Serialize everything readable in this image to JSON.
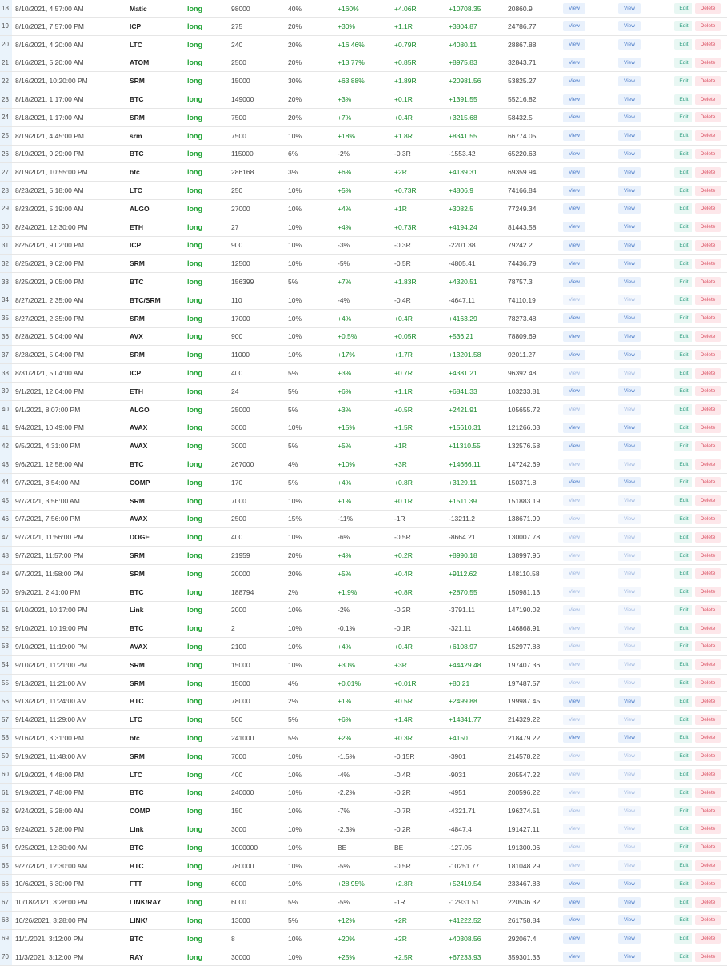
{
  "buttons": {
    "view": "View",
    "edit": "Edit",
    "delete": "Delete"
  },
  "colors": {
    "positive": "#178a2b",
    "long": "#21a336",
    "view_bg": "#e9f1fc",
    "edit_bg": "#e8f7f3",
    "delete_bg": "#fde7ea",
    "row_number_bg": "#eaf3fb"
  },
  "rows": [
    {
      "num": "18",
      "date": "8/10/2021, 4:57:00 AM",
      "coin": "Matic",
      "direction": "long",
      "size": "98000",
      "risk": "40%",
      "pct": "+160%",
      "r": "+4.06R",
      "pnl": "+10708.35",
      "balance": "20860.9"
    },
    {
      "num": "19",
      "date": "8/10/2021, 7:57:00 PM",
      "coin": "ICP",
      "direction": "long",
      "size": "275",
      "risk": "20%",
      "pct": "+30%",
      "r": "+1.1R",
      "pnl": "+3804.87",
      "balance": "24786.77"
    },
    {
      "num": "20",
      "date": "8/16/2021, 4:20:00 AM",
      "coin": "LTC",
      "direction": "long",
      "size": "240",
      "risk": "20%",
      "pct": "+16.46%",
      "r": "+0.79R",
      "pnl": "+4080.11",
      "balance": "28867.88"
    },
    {
      "num": "21",
      "date": "8/16/2021, 5:20:00 AM",
      "coin": "ATOM",
      "direction": "long",
      "size": "2500",
      "risk": "20%",
      "pct": "+13.77%",
      "r": "+0.85R",
      "pnl": "+8975.83",
      "balance": "32843.71"
    },
    {
      "num": "22",
      "date": "8/16/2021, 10:20:00 PM",
      "coin": "SRM",
      "direction": "long",
      "size": "15000",
      "risk": "30%",
      "pct": "+63.88%",
      "r": "+1.89R",
      "pnl": "+20981.56",
      "balance": "53825.27"
    },
    {
      "num": "23",
      "date": "8/18/2021, 1:17:00 AM",
      "coin": "BTC",
      "direction": "long",
      "size": "149000",
      "risk": "20%",
      "pct": "+3%",
      "r": "+0.1R",
      "pnl": "+1391.55",
      "balance": "55216.82"
    },
    {
      "num": "24",
      "date": "8/18/2021, 1:17:00 AM",
      "coin": "SRM",
      "direction": "long",
      "size": "7500",
      "risk": "20%",
      "pct": "+7%",
      "r": "+0.4R",
      "pnl": "+3215.68",
      "balance": "58432.5"
    },
    {
      "num": "25",
      "date": "8/19/2021, 4:45:00 PM",
      "coin": "srm",
      "direction": "long",
      "size": "7500",
      "risk": "10%",
      "pct": "+18%",
      "r": "+1.8R",
      "pnl": "+8341.55",
      "balance": "66774.05"
    },
    {
      "num": "26",
      "date": "8/19/2021, 9:29:00 PM",
      "coin": "BTC",
      "direction": "long",
      "size": "115000",
      "risk": "6%",
      "pct": "-2%",
      "r": "-0.3R",
      "pnl": "-1553.42",
      "balance": "65220.63"
    },
    {
      "num": "27",
      "date": "8/19/2021, 10:55:00 PM",
      "coin": "btc",
      "direction": "long",
      "size": "286168",
      "risk": "3%",
      "pct": "+6%",
      "r": "+2R",
      "pnl": "+4139.31",
      "balance": "69359.94"
    },
    {
      "num": "28",
      "date": "8/23/2021, 5:18:00 AM",
      "coin": "LTC",
      "direction": "long",
      "size": "250",
      "risk": "10%",
      "pct": "+5%",
      "r": "+0.73R",
      "pnl": "+4806.9",
      "balance": "74166.84"
    },
    {
      "num": "29",
      "date": "8/23/2021, 5:19:00 AM",
      "coin": "ALGO",
      "direction": "long",
      "size": "27000",
      "risk": "10%",
      "pct": "+4%",
      "r": "+1R",
      "pnl": "+3082.5",
      "balance": "77249.34"
    },
    {
      "num": "30",
      "date": "8/24/2021, 12:30:00 PM",
      "coin": "ETH",
      "direction": "long",
      "size": "27",
      "risk": "10%",
      "pct": "+4%",
      "r": "+0.73R",
      "pnl": "+4194.24",
      "balance": "81443.58"
    },
    {
      "num": "31",
      "date": "8/25/2021, 9:02:00 PM",
      "coin": "ICP",
      "direction": "long",
      "size": "900",
      "risk": "10%",
      "pct": "-3%",
      "r": "-0.3R",
      "pnl": "-2201.38",
      "balance": "79242.2"
    },
    {
      "num": "32",
      "date": "8/25/2021, 9:02:00 PM",
      "coin": "SRM",
      "direction": "long",
      "size": "12500",
      "risk": "10%",
      "pct": "-5%",
      "r": "-0.5R",
      "pnl": "-4805.41",
      "balance": "74436.79"
    },
    {
      "num": "33",
      "date": "8/25/2021, 9:05:00 PM",
      "coin": "BTC",
      "direction": "long",
      "size": "156399",
      "risk": "5%",
      "pct": "+7%",
      "r": "+1.83R",
      "pnl": "+4320.51",
      "balance": "78757.3"
    },
    {
      "num": "34",
      "date": "8/27/2021, 2:35:00 AM",
      "coin": "BTC/SRM",
      "direction": "long",
      "size": "110",
      "risk": "10%",
      "pct": "-4%",
      "r": "-0.4R",
      "pnl": "-4647.11",
      "balance": "74110.19"
    },
    {
      "num": "35",
      "date": "8/27/2021, 2:35:00 PM",
      "coin": "SRM",
      "direction": "long",
      "size": "17000",
      "risk": "10%",
      "pct": "+4%",
      "r": "+0.4R",
      "pnl": "+4163.29",
      "balance": "78273.48"
    },
    {
      "num": "36",
      "date": "8/28/2021, 5:04:00 AM",
      "coin": "AVX",
      "direction": "long",
      "size": "900",
      "risk": "10%",
      "pct": "+0.5%",
      "r": "+0.05R",
      "pnl": "+536.21",
      "balance": "78809.69"
    },
    {
      "num": "37",
      "date": "8/28/2021, 5:04:00 PM",
      "coin": "SRM",
      "direction": "long",
      "size": "11000",
      "risk": "10%",
      "pct": "+17%",
      "r": "+1.7R",
      "pnl": "+13201.58",
      "balance": "92011.27"
    },
    {
      "num": "38",
      "date": "8/31/2021, 5:04:00 AM",
      "coin": "ICP",
      "direction": "long",
      "size": "400",
      "risk": "5%",
      "pct": "+3%",
      "r": "+0.7R",
      "pnl": "+4381.21",
      "balance": "96392.48"
    },
    {
      "num": "39",
      "date": "9/1/2021, 12:04:00 PM",
      "coin": "ETH",
      "direction": "long",
      "size": "24",
      "risk": "5%",
      "pct": "+6%",
      "r": "+1.1R",
      "pnl": "+6841.33",
      "balance": "103233.81"
    },
    {
      "num": "40",
      "date": "9/1/2021, 8:07:00 PM",
      "coin": "ALGO",
      "direction": "long",
      "size": "25000",
      "risk": "5%",
      "pct": "+3%",
      "r": "+0.5R",
      "pnl": "+2421.91",
      "balance": "105655.72"
    },
    {
      "num": "41",
      "date": "9/4/2021, 10:49:00 PM",
      "coin": "AVAX",
      "direction": "long",
      "size": "3000",
      "risk": "10%",
      "pct": "+15%",
      "r": "+1.5R",
      "pnl": "+15610.31",
      "balance": "121266.03"
    },
    {
      "num": "42",
      "date": "9/5/2021, 4:31:00 PM",
      "coin": "AVAX",
      "direction": "long",
      "size": "3000",
      "risk": "5%",
      "pct": "+5%",
      "r": "+1R",
      "pnl": "+11310.55",
      "balance": "132576.58"
    },
    {
      "num": "43",
      "date": "9/6/2021, 12:58:00 AM",
      "coin": "BTC",
      "direction": "long",
      "size": "267000",
      "risk": "4%",
      "pct": "+10%",
      "r": "+3R",
      "pnl": "+14666.11",
      "balance": "147242.69"
    },
    {
      "num": "44",
      "date": "9/7/2021, 3:54:00 AM",
      "coin": "COMP",
      "direction": "long",
      "size": "170",
      "risk": "5%",
      "pct": "+4%",
      "r": "+0.8R",
      "pnl": "+3129.11",
      "balance": "150371.8"
    },
    {
      "num": "45",
      "date": "9/7/2021, 3:56:00 AM",
      "coin": "SRM",
      "direction": "long",
      "size": "7000",
      "risk": "10%",
      "pct": "+1%",
      "r": "+0.1R",
      "pnl": "+1511.39",
      "balance": "151883.19"
    },
    {
      "num": "46",
      "date": "9/7/2021, 7:56:00 PM",
      "coin": "AVAX",
      "direction": "long",
      "size": "2500",
      "risk": "15%",
      "pct": "-11%",
      "r": "-1R",
      "pnl": "-13211.2",
      "balance": "138671.99"
    },
    {
      "num": "47",
      "date": "9/7/2021, 11:56:00 PM",
      "coin": "DOGE",
      "direction": "long",
      "size": "400",
      "risk": "10%",
      "pct": "-6%",
      "r": "-0.5R",
      "pnl": "-8664.21",
      "balance": "130007.78"
    },
    {
      "num": "48",
      "date": "9/7/2021, 11:57:00 PM",
      "coin": "SRM",
      "direction": "long",
      "size": "21959",
      "risk": "20%",
      "pct": "+4%",
      "r": "+0.2R",
      "pnl": "+8990.18",
      "balance": "138997.96"
    },
    {
      "num": "49",
      "date": "9/7/2021, 11:58:00 PM",
      "coin": "SRM",
      "direction": "long",
      "size": "20000",
      "risk": "20%",
      "pct": "+5%",
      "r": "+0.4R",
      "pnl": "+9112.62",
      "balance": "148110.58"
    },
    {
      "num": "50",
      "date": "9/9/2021, 2:41:00 PM",
      "coin": "BTC",
      "direction": "long",
      "size": "188794",
      "risk": "2%",
      "pct": "+1.9%",
      "r": "+0.8R",
      "pnl": "+2870.55",
      "balance": "150981.13"
    },
    {
      "num": "51",
      "date": "9/10/2021, 10:17:00 PM",
      "coin": "Link",
      "direction": "long",
      "size": "2000",
      "risk": "10%",
      "pct": "-2%",
      "r": "-0.2R",
      "pnl": "-3791.11",
      "balance": "147190.02"
    },
    {
      "num": "52",
      "date": "9/10/2021, 10:19:00 PM",
      "coin": "BTC",
      "direction": "long",
      "size": "2",
      "risk": "10%",
      "pct": "-0.1%",
      "r": "-0.1R",
      "pnl": "-321.11",
      "balance": "146868.91"
    },
    {
      "num": "53",
      "date": "9/10/2021, 11:19:00 PM",
      "coin": "AVAX",
      "direction": "long",
      "size": "2100",
      "risk": "10%",
      "pct": "+4%",
      "r": "+0.4R",
      "pnl": "+6108.97",
      "balance": "152977.88"
    },
    {
      "num": "54",
      "date": "9/10/2021, 11:21:00 PM",
      "coin": "SRM",
      "direction": "long",
      "size": "15000",
      "risk": "10%",
      "pct": "+30%",
      "r": "+3R",
      "pnl": "+44429.48",
      "balance": "197407.36"
    },
    {
      "num": "55",
      "date": "9/13/2021, 11:21:00 AM",
      "coin": "SRM",
      "direction": "long",
      "size": "15000",
      "risk": "4%",
      "pct": "+0.01%",
      "r": "+0.01R",
      "pnl": "+80.21",
      "balance": "197487.57"
    },
    {
      "num": "56",
      "date": "9/13/2021, 11:24:00 AM",
      "coin": "BTC",
      "direction": "long",
      "size": "78000",
      "risk": "2%",
      "pct": "+1%",
      "r": "+0.5R",
      "pnl": "+2499.88",
      "balance": "199987.45"
    },
    {
      "num": "57",
      "date": "9/14/2021, 11:29:00 AM",
      "coin": "LTC",
      "direction": "long",
      "size": "500",
      "risk": "5%",
      "pct": "+6%",
      "r": "+1.4R",
      "pnl": "+14341.77",
      "balance": "214329.22"
    },
    {
      "num": "58",
      "date": "9/16/2021, 3:31:00 PM",
      "coin": "btc",
      "direction": "long",
      "size": "241000",
      "risk": "5%",
      "pct": "+2%",
      "r": "+0.3R",
      "pnl": "+4150",
      "balance": "218479.22"
    },
    {
      "num": "59",
      "date": "9/19/2021, 11:48:00 AM",
      "coin": "SRM",
      "direction": "long",
      "size": "7000",
      "risk": "10%",
      "pct": "-1.5%",
      "r": "-0.15R",
      "pnl": "-3901",
      "balance": "214578.22"
    },
    {
      "num": "60",
      "date": "9/19/2021, 4:48:00 PM",
      "coin": "LTC",
      "direction": "long",
      "size": "400",
      "risk": "10%",
      "pct": "-4%",
      "r": "-0.4R",
      "pnl": "-9031",
      "balance": "205547.22"
    },
    {
      "num": "61",
      "date": "9/19/2021, 7:48:00 PM",
      "coin": "BTC",
      "direction": "long",
      "size": "240000",
      "risk": "10%",
      "pct": "-2.2%",
      "r": "-0.2R",
      "pnl": "-4951",
      "balance": "200596.22"
    },
    {
      "num": "62",
      "date": "9/24/2021, 5:28:00 AM",
      "coin": "COMP",
      "direction": "long",
      "size": "150",
      "risk": "10%",
      "pct": "-7%",
      "r": "-0.7R",
      "pnl": "-4321.71",
      "balance": "196274.51"
    },
    {
      "num": "63",
      "date": "9/24/2021, 5:28:00 PM",
      "coin": "Link",
      "direction": "long",
      "size": "3000",
      "risk": "10%",
      "pct": "-2.3%",
      "r": "-0.2R",
      "pnl": "-4847.4",
      "balance": "191427.11"
    },
    {
      "num": "64",
      "date": "9/25/2021, 12:30:00 AM",
      "coin": "BTC",
      "direction": "long",
      "size": "1000000",
      "risk": "10%",
      "pct": "BE",
      "r": "BE",
      "pnl": "-127.05",
      "balance": "191300.06"
    },
    {
      "num": "65",
      "date": "9/27/2021, 12:30:00 AM",
      "coin": "BTC",
      "direction": "long",
      "size": "780000",
      "risk": "10%",
      "pct": "-5%",
      "r": "-0.5R",
      "pnl": "-10251.77",
      "balance": "181048.29"
    },
    {
      "num": "66",
      "date": "10/6/2021, 6:30:00 PM",
      "coin": "FTT",
      "direction": "long",
      "size": "6000",
      "risk": "10%",
      "pct": "+28.95%",
      "r": "+2.8R",
      "pnl": "+52419.54",
      "balance": "233467.83"
    },
    {
      "num": "67",
      "date": "10/18/2021, 3:28:00 PM",
      "coin": "LINK/RAY",
      "direction": "long",
      "size": "6000",
      "risk": "5%",
      "pct": "-5%",
      "r": "-1R",
      "pnl": "-12931.51",
      "balance": "220536.32"
    },
    {
      "num": "68",
      "date": "10/26/2021, 3:28:00 PM",
      "coin": "LINK/",
      "direction": "long",
      "size": "13000",
      "risk": "5%",
      "pct": "+12%",
      "r": "+2R",
      "pnl": "+41222.52",
      "balance": "261758.84"
    },
    {
      "num": "69",
      "date": "11/1/2021, 3:12:00 PM",
      "coin": "BTC",
      "direction": "long",
      "size": "8",
      "risk": "10%",
      "pct": "+20%",
      "r": "+2R",
      "pnl": "+40308.56",
      "balance": "292067.4"
    },
    {
      "num": "70",
      "date": "11/3/2021, 3:12:00 PM",
      "coin": "RAY",
      "direction": "long",
      "size": "30000",
      "risk": "10%",
      "pct": "+25%",
      "r": "+2.5R",
      "pnl": "+67233.93",
      "balance": "359301.33"
    }
  ]
}
